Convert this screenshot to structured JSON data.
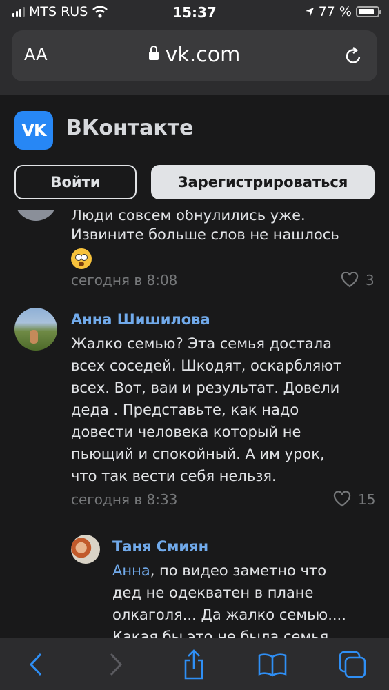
{
  "status_bar": {
    "carrier": "MTS RUS",
    "time": "15:37",
    "battery": "77 %"
  },
  "browser": {
    "text_size_label": "AA",
    "url": "vk.com"
  },
  "vk": {
    "logo_text": "VK",
    "title": "ВКонтакте",
    "login_label": "Войти",
    "register_label": "Зарегистрироваться"
  },
  "comments": [
    {
      "text_cut": "Люди совсем обнулились уже.",
      "text": "Извините больше слов не нашлось",
      "time": "сегодня в 8:08",
      "likes": "3"
    },
    {
      "author": "Анна Шишилова",
      "text": "Жалко семью? Эта семья достала\nвсех соседей. Шкодят, оскарбляют\nвсех. Вот, ваи и результат. Довели\nдеда . Представьте, как надо\nдовести человека который не\nпьющий и спокойный. А им урок,\nчто так вести себя нельзя.",
      "time": "сегодня в 8:33",
      "likes": "15"
    },
    {
      "author": "Таня Смиян",
      "mention": "Анна",
      "text_first": ", по видео заметно что",
      "text_rest": "дед не одекватен в плане\nолкаголя... Да жалко семью....\nКакая бы это не была семья"
    }
  ],
  "colors": {
    "background": "#19191a",
    "bar": "#2c2c2e",
    "link": "#71aaeb",
    "accent": "#2787f5"
  }
}
